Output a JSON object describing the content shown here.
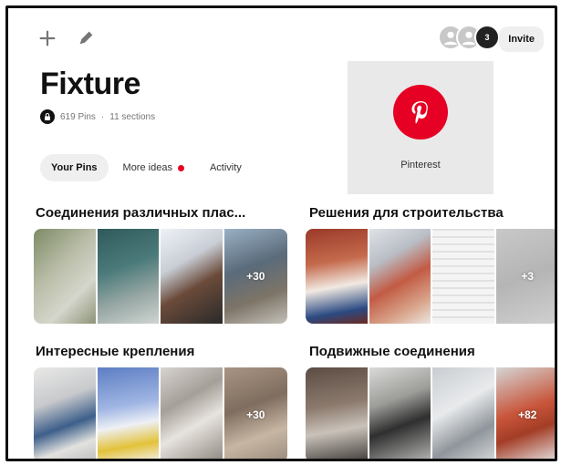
{
  "toolbar": {
    "add_icon": "plus-icon",
    "edit_icon": "pencil-icon"
  },
  "collaborators": {
    "count_badge": "3"
  },
  "invite_label": "Invite",
  "board": {
    "title": "Fixture",
    "pins": "619 Pins",
    "separator": "·",
    "sections": "11 sections"
  },
  "tabs": [
    {
      "label": "Your Pins",
      "active": true
    },
    {
      "label": "More ideas",
      "badge": true
    },
    {
      "label": "Activity"
    }
  ],
  "cover": {
    "label": "Pinterest"
  },
  "section_list": [
    {
      "title": "Соединения различных плас...",
      "more": "+30"
    },
    {
      "title": "Решения для строительства",
      "more": "+3"
    },
    {
      "title": "Интересные крепления",
      "more": "+30"
    },
    {
      "title": "Подвижные соединения",
      "more": "+82"
    }
  ],
  "colors": {
    "brand": "#e60023",
    "pill": "#efefef",
    "muted": "#767676"
  }
}
